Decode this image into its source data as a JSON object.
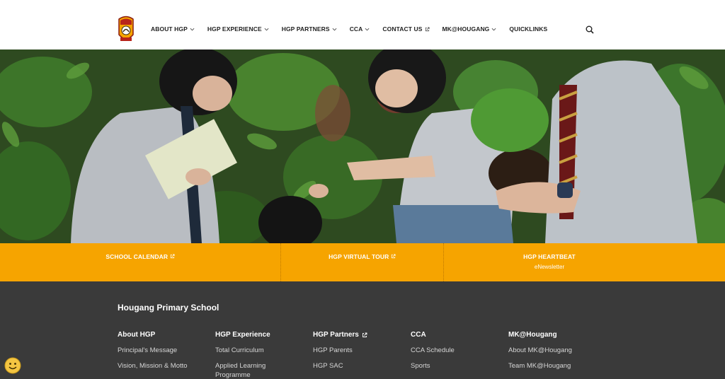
{
  "header": {
    "nav": [
      {
        "label": "ABOUT HGP",
        "icon": "chevron-down-icon"
      },
      {
        "label": "HGP EXPERIENCE",
        "icon": "chevron-down-icon"
      },
      {
        "label": "HGP PARTNERS",
        "icon": "chevron-down-icon"
      },
      {
        "label": "CCA",
        "icon": "chevron-down-icon"
      },
      {
        "label": "CONTACT US",
        "icon": "external-link-icon"
      },
      {
        "label": "MK@HOUGANG",
        "icon": "chevron-down-icon"
      },
      {
        "label": "QUICKLINKS",
        "icon": ""
      }
    ]
  },
  "quickbar": {
    "items": [
      {
        "label": "SCHOOL CALENDAR",
        "sub": ""
      },
      {
        "label": "HGP VIRTUAL TOUR",
        "sub": ""
      },
      {
        "label": "HGP HEARTBEAT",
        "sub": "eNewsletter"
      }
    ]
  },
  "footer": {
    "title": "Hougang Primary School",
    "columns": [
      {
        "heading": "About HGP",
        "links": [
          "Principal's Message",
          "Vision, Mission & Motto"
        ]
      },
      {
        "heading": "HGP Experience",
        "links": [
          "Total Curriculum",
          "Applied Learning Programme"
        ]
      },
      {
        "heading": "HGP Partners",
        "links": [
          "HGP Parents",
          "HGP SAC"
        ]
      },
      {
        "heading": "CCA",
        "links": [
          "CCA Schedule",
          "Sports"
        ]
      },
      {
        "heading": "MK@Hougang",
        "links": [
          "About MK@Hougang",
          "Team MK@Hougang"
        ]
      }
    ]
  },
  "colors": {
    "accent": "#f6a400",
    "footer_bg": "#3a3a3a",
    "header_bg": "#ffffff"
  }
}
